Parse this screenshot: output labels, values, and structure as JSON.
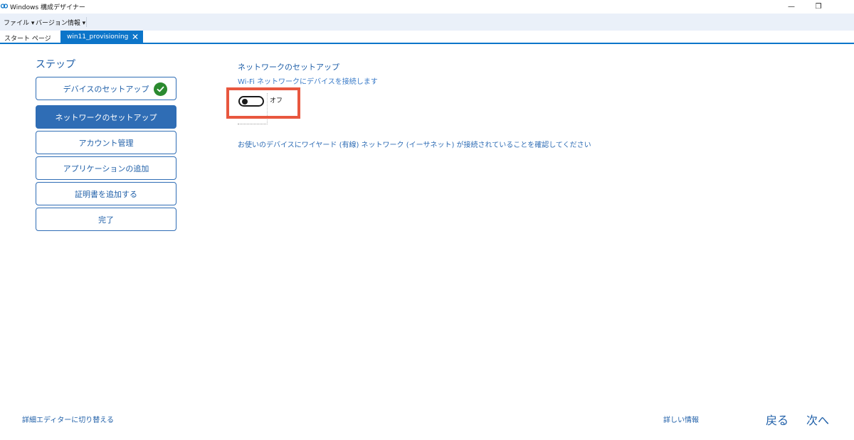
{
  "window": {
    "title": "Windows 構成デザイナー",
    "minimize_glyph": "—",
    "restore_glyph": "❐"
  },
  "menu": {
    "file": "ファイル ▾",
    "version": "バージョン情報 ▾"
  },
  "tabs": {
    "start": "スタート ページ",
    "active": "win11_provisioning",
    "close_glyph": "✕"
  },
  "steps": {
    "heading": "ステップ",
    "items": [
      {
        "label": "デバイスのセットアップ",
        "state": "completed"
      },
      {
        "label": "ネットワークのセットアップ",
        "state": "current"
      },
      {
        "label": "アカウント管理",
        "state": "pending"
      },
      {
        "label": "アプリケーションの追加",
        "state": "pending"
      },
      {
        "label": "証明書を追加する",
        "state": "pending"
      },
      {
        "label": "完了",
        "state": "pending"
      }
    ]
  },
  "main": {
    "title": "ネットワークのセットアップ",
    "subtitle": "Wi-Fi ネットワークにデバイスを接続します",
    "toggle_label": "オフ",
    "toggle_on": false,
    "info": "お使いのデバイスにワイヤード (有線) ネットワーク (イーサネット) が接続されていることを確認してください"
  },
  "footer": {
    "switch_editor": "詳細エディターに切り替える",
    "details": "詳しい情報",
    "back": "戻る",
    "next": "次へ"
  },
  "colors": {
    "accent": "#0c75c9",
    "step_blue": "#2f6db5",
    "check_green": "#2b8a2f",
    "highlight_red": "#e8573f"
  },
  "icons": {
    "app": "designer-logo-icon",
    "check": "check-circle-icon"
  }
}
